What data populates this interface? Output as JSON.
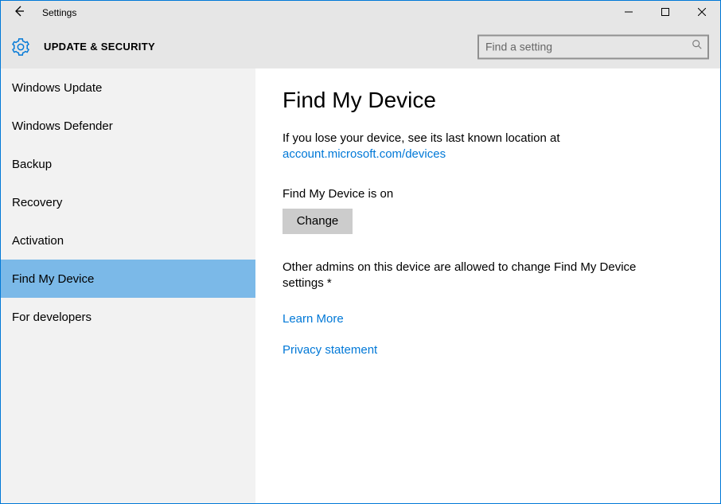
{
  "window": {
    "title": "Settings"
  },
  "header": {
    "title": "UPDATE & SECURITY",
    "search_placeholder": "Find a setting"
  },
  "sidebar": {
    "items": [
      {
        "label": "Windows Update"
      },
      {
        "label": "Windows Defender"
      },
      {
        "label": "Backup"
      },
      {
        "label": "Recovery"
      },
      {
        "label": "Activation"
      },
      {
        "label": "Find My Device"
      },
      {
        "label": "For developers"
      }
    ],
    "selected_index": 5
  },
  "main": {
    "page_title": "Find My Device",
    "lose_text": "If you lose your device, see its last known location at",
    "account_link": "account.microsoft.com/devices",
    "status_text": "Find My Device is on",
    "change_label": "Change",
    "admins_text": "Other admins on this device are allowed to change Find My Device settings *",
    "learn_more": "Learn More",
    "privacy": "Privacy statement"
  }
}
